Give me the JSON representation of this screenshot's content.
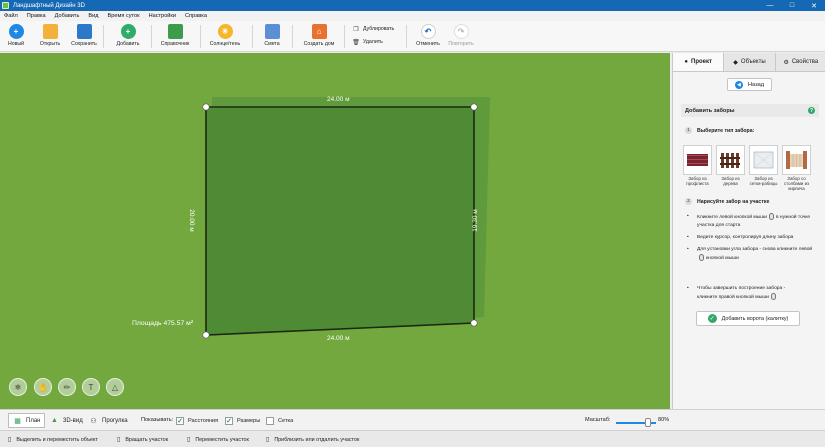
{
  "window": {
    "title": "Ландшафтный Дизайн 3D"
  },
  "menu": [
    "Файл",
    "Правка",
    "Добавить",
    "Вид",
    "Время суток",
    "Настройки",
    "Справка"
  ],
  "toolbar": {
    "new": "Новый",
    "open": "Открыть",
    "save": "Сохранить",
    "add": "Добавить",
    "reference": "Справочник",
    "sun_shadow": "Солнце/тень",
    "estimate": "Смета",
    "build_house": "Создать дом",
    "duplicate": "Дублировать",
    "delete": "Удалить",
    "undo": "Отменить",
    "redo": "Повторить"
  },
  "plot": {
    "top_dim": "24.00 м",
    "bottom_dim": "24.00 м",
    "left_dim": "20.00 м",
    "right_dim": "19.30 м",
    "area_label": "Площадь 475.57  м²"
  },
  "panel": {
    "tabs": [
      "Проект",
      "Объекты",
      "Свойства"
    ],
    "back": "Назад",
    "section_title": "Добавить заборы",
    "help": "?",
    "step1_num": "1",
    "step1": "Выберите тип забора:",
    "fence_types": [
      "Забор из профлиста",
      "Забор из дерева",
      "Забор из сетки-рабицы",
      "Забор со столбами из кирпича"
    ],
    "step2_num": "2",
    "step2": "Нарисуйте забор на участке",
    "instr1a": "Кликните левой кнопкой мыши",
    "instr1b": "в нужной точке участка для старта",
    "instr2": "Ведите курсор, контролируя длину забора",
    "instr3a": "Для установки угла забора - снова кликните левой",
    "instr3b": "кнопкой мыши",
    "instr4a": "Чтобы завершить построение забора -",
    "instr4b": "кликните правой кнопкой мыши",
    "add_gate": "Добавить ворота (калитку)"
  },
  "viewbar": {
    "plan": "План",
    "view3d": "3D-вид",
    "walk": "Прогулка",
    "show_label": "Показывать:",
    "distances": "Расстояния",
    "sizes": "Размеры",
    "grid": "Сетка",
    "zoom_label": "Масштаб:",
    "zoom_value": "80%",
    "zoom_fraction": 0.8
  },
  "status": {
    "select_move": "Выделить и переместить объект",
    "rotate": "Вращать участок",
    "move": "Переместить участок",
    "zoom": "Приблизить или отдалить участок"
  },
  "colors": {
    "titlebar": "#1569b4",
    "lawn": "#72a83e",
    "plot_fill": "#4f8a34",
    "accent_blue": "#1e88e5",
    "accent_green": "#33a66b"
  }
}
